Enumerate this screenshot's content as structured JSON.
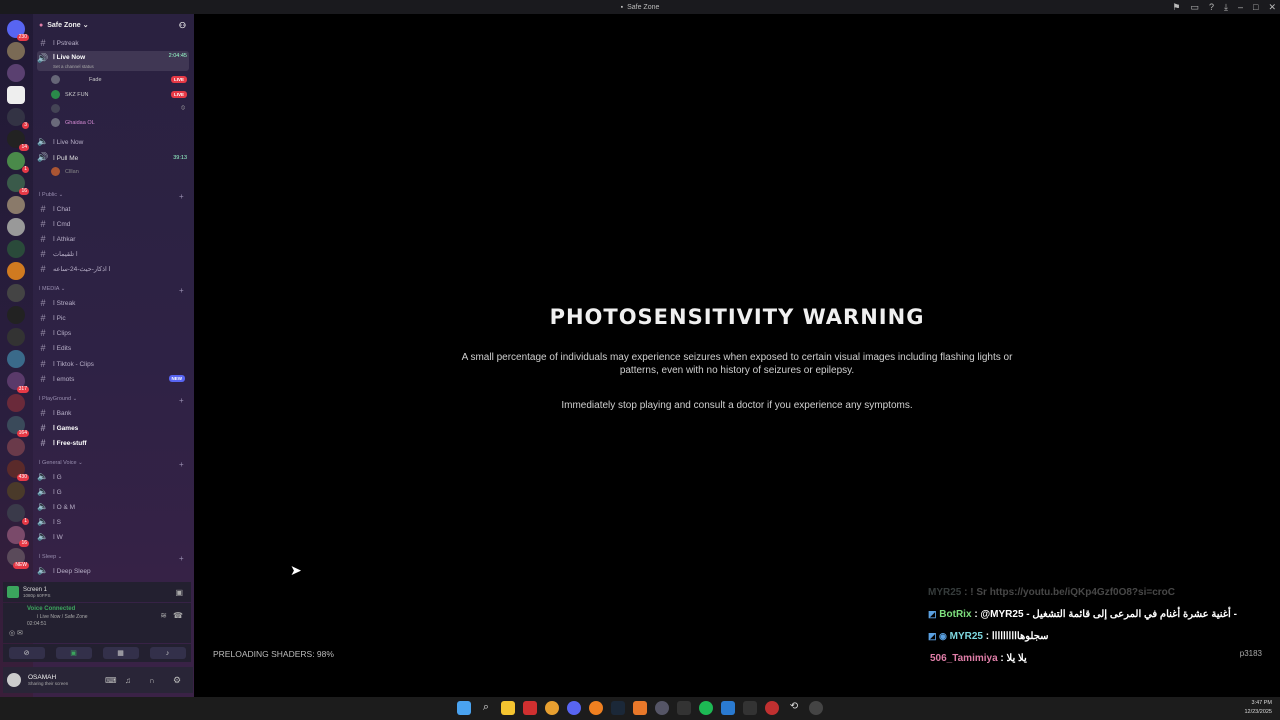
{
  "window": {
    "title": "Safe Zone"
  },
  "rail": {
    "badges": [
      "230",
      "3",
      "14",
      "1",
      "16",
      "317",
      "164",
      "430",
      "1",
      "16",
      "NEW"
    ]
  },
  "sidebar": {
    "server_name": "Safe Zone",
    "channels_top": [
      {
        "label": "ا Pstreak"
      },
      {
        "label": "ا Live Now",
        "time": "2:04:45",
        "status": "Set a channel status"
      }
    ],
    "live_users": [
      {
        "name": "Fade",
        "live": "LIVE"
      },
      {
        "name": "SKZ FUN",
        "live": "LIVE"
      },
      {
        "name": "",
        "live": ""
      },
      {
        "name": "Ghaidaa OL",
        "live": ""
      }
    ],
    "channels_voice": [
      {
        "label": "ا Live Now"
      },
      {
        "label": "ا Pull Me",
        "time": "39:13"
      },
      {
        "label": "Clllan"
      }
    ],
    "cat_public": "ا Public",
    "public_channels": [
      "ا Chat",
      "ا Cmd",
      "ا Athkar",
      "ا تلقيمات",
      "ا اذكار-حيث-24-ساعه"
    ],
    "cat_media": "ا MEDIA",
    "media_channels": [
      "ا Streak",
      "ا Pic",
      "ا Clips",
      "ا Edits",
      "ا Tiktok - Clips",
      "ا emots"
    ],
    "new_label": "NEW",
    "cat_playground": "ا PlayGround",
    "playground_channels": [
      "ا Bank",
      "ا Games",
      "ا Free-stuff"
    ],
    "cat_general_voice": "ا General Voice",
    "voice_channels": [
      "ا G",
      "ا G",
      "ا O & M",
      "ا S",
      "ا W"
    ],
    "cat_sleep": "ا Sleep",
    "sleep_channels": [
      "ا Deep Sleep"
    ]
  },
  "screen_panel": {
    "title": "Screen 1",
    "sub": "1080p 60FPS"
  },
  "voice_panel": {
    "status": "Voice Connected",
    "channel": "ا Live Now / Safe Zone",
    "time": "02:04:51"
  },
  "user_panel": {
    "name": "OSAMAH",
    "status": "Sharing their screen"
  },
  "game": {
    "warning_title": "PHOTOSENSITIVITY WARNING",
    "warning_text": "A small percentage of individuals may experience seizures when exposed to certain visual images including flashing lights or patterns, even with no history of seizures or epilepsy.",
    "warning_text2": "Immediately stop playing and consult a doctor if you experience any symptoms.",
    "preload": "PRELOADING SHADERS: 98%",
    "code": "p3183"
  },
  "chat": [
    {
      "user": "MYR25",
      "text": ": ! Sr https://youtu.be/iQKp4Gzf0O8?si=croC",
      "color": "#9aa"
    },
    {
      "user": "BotRix",
      "text": ": @MYR25 - أغنية عشرة أغنام في المرعى إلى قائمة التشغيل -",
      "color": "#7ee07e"
    },
    {
      "user": "MYR25",
      "text": ": سجلوهاااااااااا",
      "color": "#7ed8e0"
    },
    {
      "user": "506_Tamimiya",
      "text": ": يلا يلا",
      "color": "#e07ea8"
    }
  ],
  "tray": {
    "time": "3:47 PM",
    "date": "12/23/2025"
  }
}
